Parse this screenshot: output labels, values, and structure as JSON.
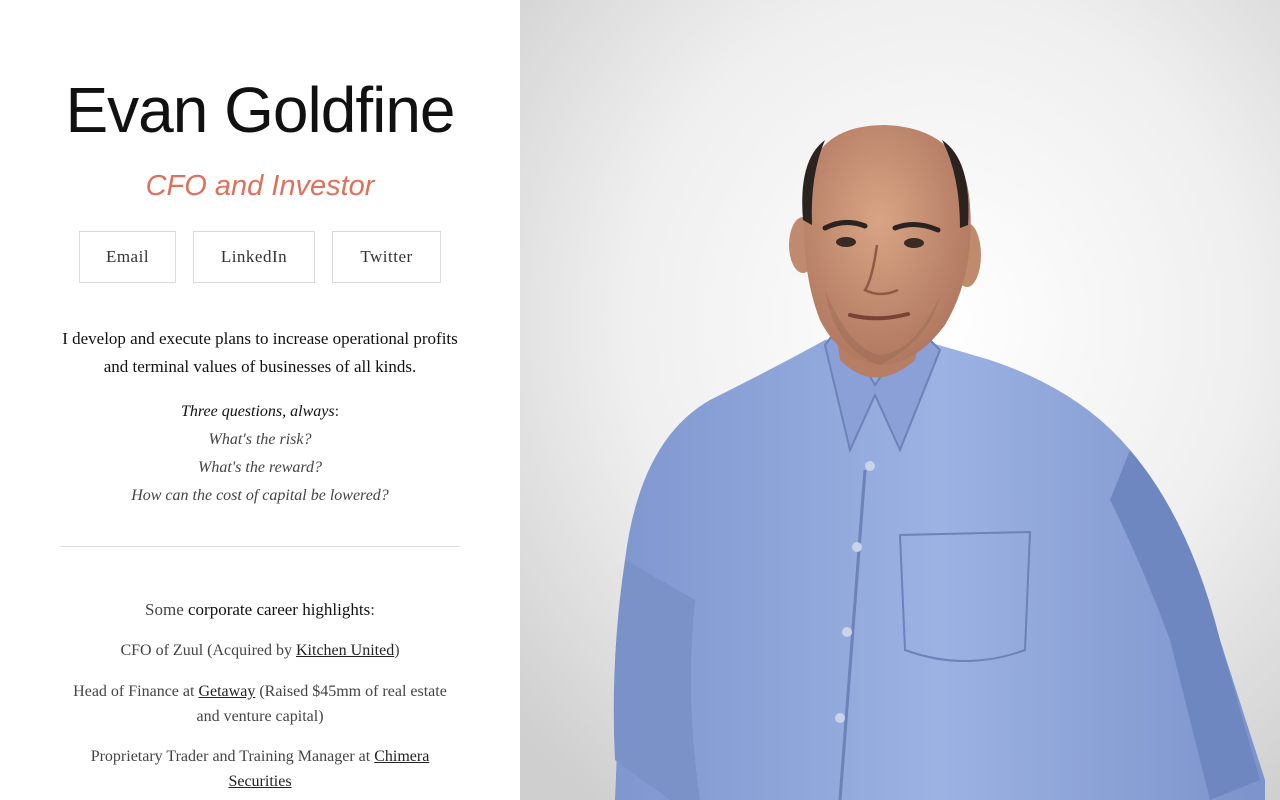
{
  "profile": {
    "name": "Evan Goldfine",
    "tagline": "CFO and Investor"
  },
  "links": {
    "email": "Email",
    "linkedin": "LinkedIn",
    "twitter": "Twitter"
  },
  "intro": "I develop and execute plans to increase operational profits and terminal values of businesses of all kinds.",
  "questions": {
    "lead": "Three questions, always",
    "colon": ":",
    "items": [
      "What's the risk?",
      "What's the reward?",
      "How can the cost of capital be lowered?"
    ]
  },
  "highlights": {
    "prefix": "Some ",
    "strong": "corporate career highlights",
    "suffix": ":",
    "items": [
      {
        "before": "CFO of Zuul (Acquired by ",
        "link": "Kitchen United",
        "after": ")"
      },
      {
        "before": "Head of Finance at ",
        "link": "Getaway",
        "after": " (Raised $45mm of real estate and venture capital)"
      },
      {
        "before": "Proprietary Trader and Training Manager at ",
        "link": "Chimera Securities",
        "after": ""
      }
    ]
  },
  "colors": {
    "accent": "#e0705a",
    "shirt": "#8ea6dc",
    "background": "#ffffff"
  }
}
